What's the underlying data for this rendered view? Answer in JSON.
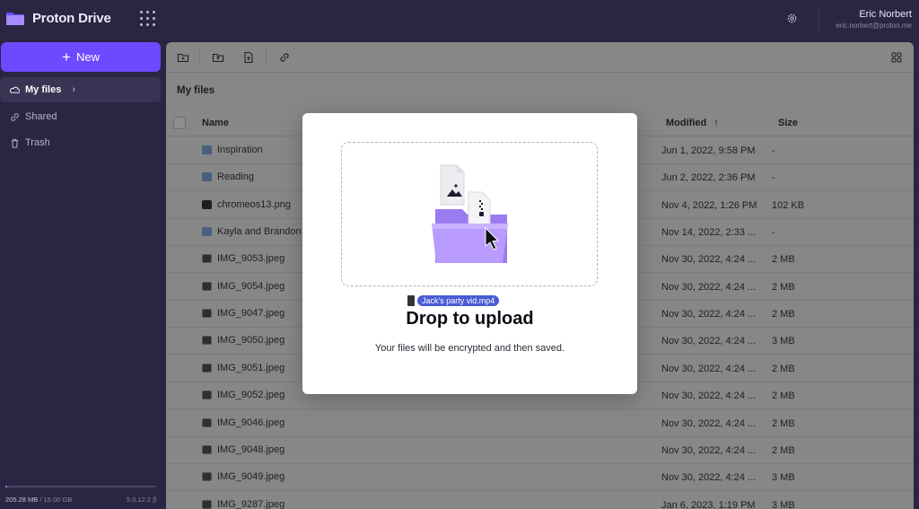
{
  "app": {
    "name": "Proton Drive"
  },
  "user": {
    "name": "Eric Norbert",
    "email": "eric.norbert@proton.me"
  },
  "sidebar": {
    "new_label": "New",
    "items": [
      {
        "label": "My files",
        "icon": "cloud-icon",
        "active": true
      },
      {
        "label": "Shared",
        "icon": "link-icon",
        "active": false
      },
      {
        "label": "Trash",
        "icon": "trash-icon",
        "active": false
      }
    ],
    "storage_used": "205.28 MB",
    "storage_total": "/ 15.00 GB",
    "storage_fraction": 0.014,
    "version": "5.0.12.2 β"
  },
  "main": {
    "title": "My files",
    "columns": {
      "name": "Name",
      "modified": "Modified",
      "sort_arrow": "↑",
      "size": "Size"
    },
    "rows": [
      {
        "name": "Inspiration",
        "type": "folder",
        "modified": "Jun 1, 2022, 9:58 PM",
        "size": "-"
      },
      {
        "name": "Reading",
        "type": "folder",
        "modified": "Jun 2, 2022, 2:36 PM",
        "size": "-"
      },
      {
        "name": "chromeos13.png",
        "type": "dark",
        "modified": "Nov 4, 2022, 1:26 PM",
        "size": "102 KB"
      },
      {
        "name": "Kayla and Brandon",
        "type": "folder",
        "modified": "Nov 14, 2022, 2:33 ...",
        "size": "-"
      },
      {
        "name": "IMG_9053.jpeg",
        "type": "img",
        "modified": "Nov 30, 2022, 4:24 ...",
        "size": "2 MB"
      },
      {
        "name": "IMG_9054.jpeg",
        "type": "img",
        "modified": "Nov 30, 2022, 4:24 ...",
        "size": "2 MB"
      },
      {
        "name": "IMG_9047.jpeg",
        "type": "img",
        "modified": "Nov 30, 2022, 4:24 ...",
        "size": "2 MB"
      },
      {
        "name": "IMG_9050.jpeg",
        "type": "img",
        "modified": "Nov 30, 2022, 4:24 ...",
        "size": "3 MB"
      },
      {
        "name": "IMG_9051.jpeg",
        "type": "img",
        "modified": "Nov 30, 2022, 4:24 ...",
        "size": "2 MB"
      },
      {
        "name": "IMG_9052.jpeg",
        "type": "img",
        "modified": "Nov 30, 2022, 4:24 ...",
        "size": "2 MB"
      },
      {
        "name": "IMG_9046.jpeg",
        "type": "img",
        "modified": "Nov 30, 2022, 4:24 ...",
        "size": "2 MB"
      },
      {
        "name": "IMG_9048.jpeg",
        "type": "img",
        "modified": "Nov 30, 2022, 4:24 ...",
        "size": "2 MB"
      },
      {
        "name": "IMG_9049.jpeg",
        "type": "img",
        "modified": "Nov 30, 2022, 4:24 ...",
        "size": "3 MB"
      },
      {
        "name": "IMG_9287.jpeg",
        "type": "img",
        "modified": "Jan 6, 2023, 1:19 PM",
        "size": "3 MB"
      }
    ]
  },
  "modal": {
    "dragged_file": "Jack's party vid.mp4",
    "title": "Drop to upload",
    "subtitle": "Your files will be encrypted and then saved."
  },
  "colors": {
    "accent": "#6d4aff",
    "sidebar_bg": "#2a2542",
    "overlay": "#878787"
  }
}
